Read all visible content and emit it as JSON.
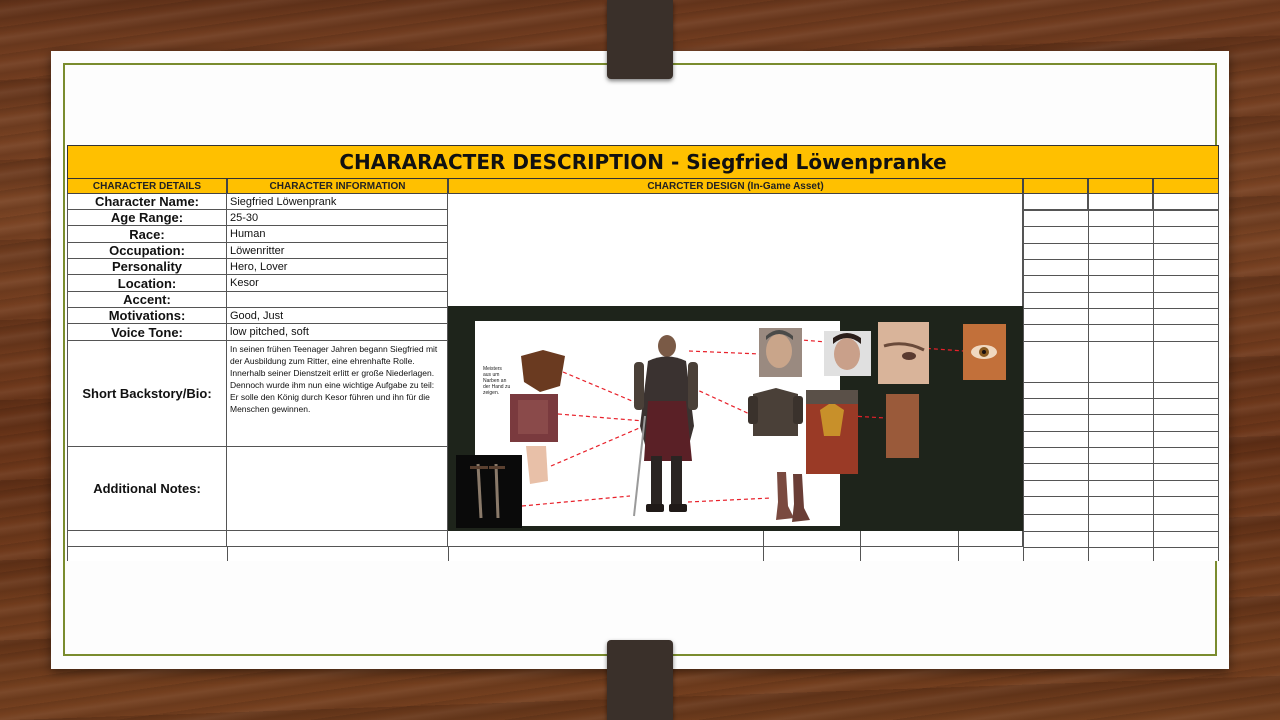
{
  "title": "CHARARACTER DESCRIPTION - Siegfried Löwenpranke",
  "headers": {
    "details": "CHARACTER DETAILS",
    "information": "CHARACTER INFORMATION",
    "design": "CHARCTER DESIGN (In-Game Asset)"
  },
  "fields": [
    {
      "label": "Character Name:",
      "value": "Siegfried Löwenprank"
    },
    {
      "label": "Age Range:",
      "value": "25-30"
    },
    {
      "label": "Race:",
      "value": "Human"
    },
    {
      "label": "Occupation:",
      "value": "Löwenritter"
    },
    {
      "label": "Personality",
      "value": "Hero, Lover"
    },
    {
      "label": "Location:",
      "value": "Kesor"
    },
    {
      "label": "Accent:",
      "value": ""
    },
    {
      "label": "Motivations:",
      "value": "Good, Just"
    },
    {
      "label": "Voice Tone:",
      "value": "low pitched, soft"
    }
  ],
  "backstory": {
    "label": "Short Backstory/Bio:",
    "text": "In seinen frühen Teenager Jahren begann Siegfried mit der Ausbildung zum Ritter, eine ehrenhafte Rolle. Innerhalb seiner Dienstzeit erlitt er große Niederlagen. Dennoch wurde ihm nun eine wichtige Aufgabe zu teil: Er solle den König durch Kesor führen und ihn für die Menschen gewinnen."
  },
  "notes": {
    "label": "Additional Notes:",
    "value": ""
  },
  "design_note": "Meisters aus um Narben an der Hand zu zeigen.",
  "colors": {
    "accent": "#ffc000",
    "frame": "#7a8c2e",
    "dark_panel": "#1e241b"
  }
}
